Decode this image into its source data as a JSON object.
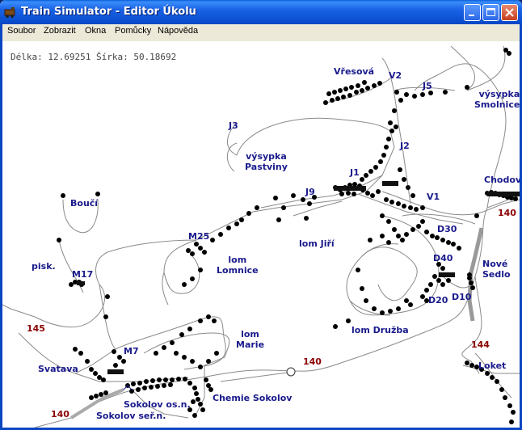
{
  "window": {
    "title": "Train Simulator - Editor Úkolu"
  },
  "menu": [
    "Soubor",
    "Zobrazit",
    "Okna",
    "Pomůcky",
    "Nápověda"
  ],
  "coords": {
    "text": "Délka: 12.69251 Šírka: 50.18692"
  },
  "labels": {
    "vresova": "Vřesová",
    "v2": "V2",
    "j5": "J5",
    "vysypka_smolnice": "výsypka\nSmolnice",
    "j3": "J3",
    "vysypka_pastviny": "výsypka\nPastviny",
    "j2": "J2",
    "j1": "J1",
    "chodov": "Chodov",
    "j9": "J9",
    "v1": "V1",
    "bouci": "Boučí",
    "d30": "D30",
    "m25": "M25",
    "lom_jiri": "lom Jiří",
    "lom_lomnice": "lom\nLomnice",
    "pisk": "pisk.",
    "m17": "M17",
    "d40": "D40",
    "nove_sedlo": "Nové\nSedlo",
    "d20": "D20",
    "d10": "D10",
    "lom_druzba": "lom Družba",
    "lom_marie": "lom\nMarie",
    "m7": "M7",
    "svatava": "Svatava",
    "loket": "Loket",
    "chemie_sokolov": "Chemie Sokolov",
    "sokolov_os": "Sokolov os.n.",
    "sokolov_ser": "Sokolov seř.n."
  },
  "speeds": {
    "s140_right": "140",
    "s145": "145",
    "s140_mid": "140",
    "s144": "144",
    "s140_left": "140"
  }
}
